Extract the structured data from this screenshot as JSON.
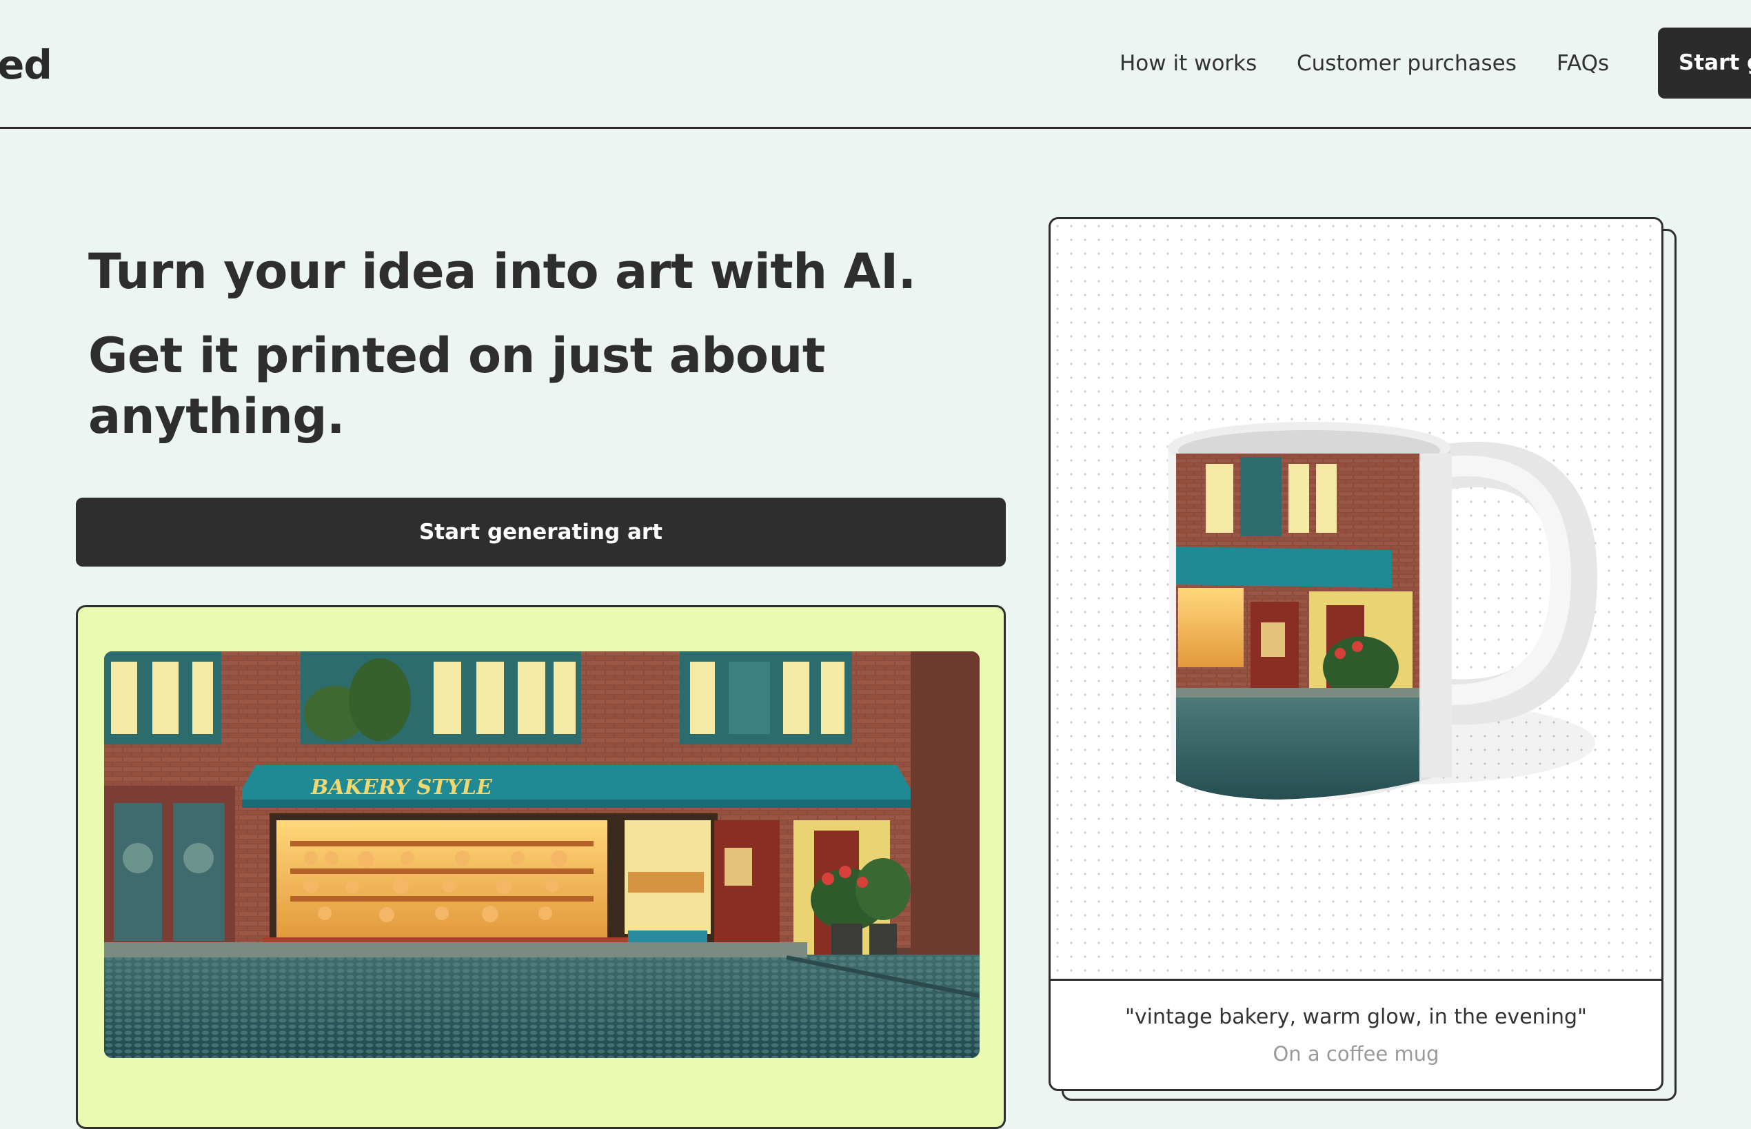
{
  "nav": {
    "brand": "ed",
    "links": [
      "How it works",
      "Customer purchases",
      "FAQs"
    ],
    "cta_label": "Start generating art"
  },
  "hero": {
    "headline": "Turn your idea into art with AI.",
    "subheadline": "Get it printed on just about anything.",
    "cta_label": "Start generating art"
  },
  "example": {
    "prompt": "\"vintage bakery, warm glow, in the evening\"",
    "product": "On a coffee mug",
    "sign_text": "BAKERY STYLE"
  },
  "colors": {
    "background": "#edf5f2",
    "dark": "#2e2e2e",
    "card_accent": "#eafab0",
    "awning": "#1f8a94"
  }
}
